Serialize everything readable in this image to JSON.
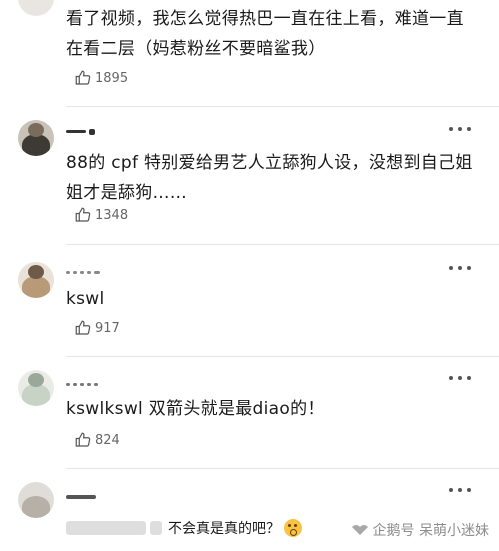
{
  "comments": [
    {
      "text": "看了视频，我怎么觉得热巴一直在往上看，难道一直在看二层（妈惹粉丝不要暗鲨我）",
      "likes": "1895"
    },
    {
      "text": "88的 cpf 特别爱给男艺人立舔狗人设，没想到自己姐姐才是舔狗……",
      "likes": "1348"
    },
    {
      "text": "kswl",
      "likes": "917"
    },
    {
      "text": "kswlkswl 双箭头就是最diao的！",
      "likes": "824"
    },
    {
      "text": "不会真是真的吧？"
    }
  ],
  "icons": {
    "like": "thumbs-up-icon",
    "more": "more-dots-icon",
    "emoji": "astonished-face-emoji"
  },
  "watermark": {
    "text": "企鹅号 呆萌小迷妹"
  }
}
